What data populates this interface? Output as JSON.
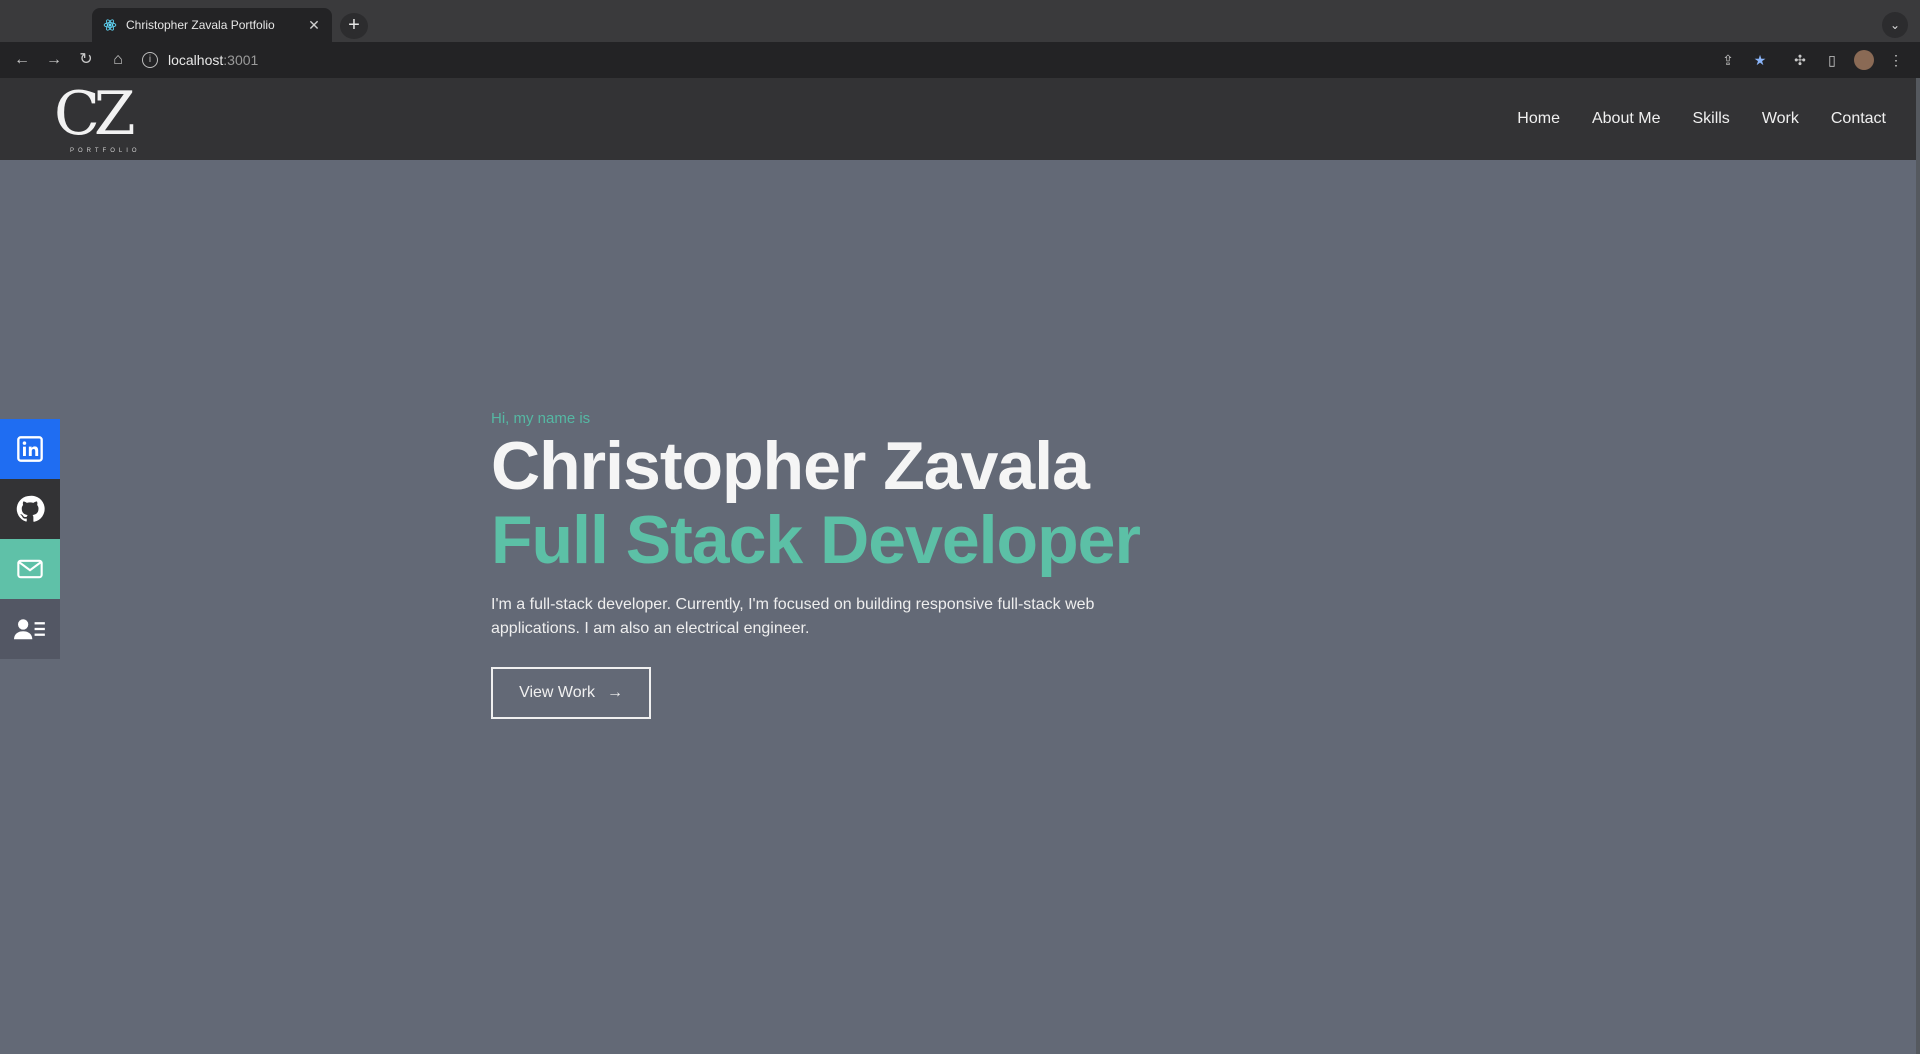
{
  "browser": {
    "tab_title": "Christopher Zavala Portfolio",
    "url_host": "localhost",
    "url_port": ":3001"
  },
  "site": {
    "logo": {
      "mark": "CZ",
      "sub": "PORTFOLIO"
    },
    "nav": [
      "Home",
      "About Me",
      "Skills",
      "Work",
      "Contact"
    ],
    "hero": {
      "greeting": "Hi, my name is",
      "name": "Christopher Zavala",
      "role": "Full Stack Developer",
      "description": "I'm a full-stack developer. Currently, I'm focused on building responsive full-stack web applications. I am also an electrical engineer.",
      "button": "View Work",
      "button_icon": "→"
    },
    "colors": {
      "page_bg": "#636976",
      "nav_bg": "#333335",
      "accent": "#5cc0a6",
      "linkedin": "#1f6df2",
      "mail": "#5fc1a8"
    }
  }
}
